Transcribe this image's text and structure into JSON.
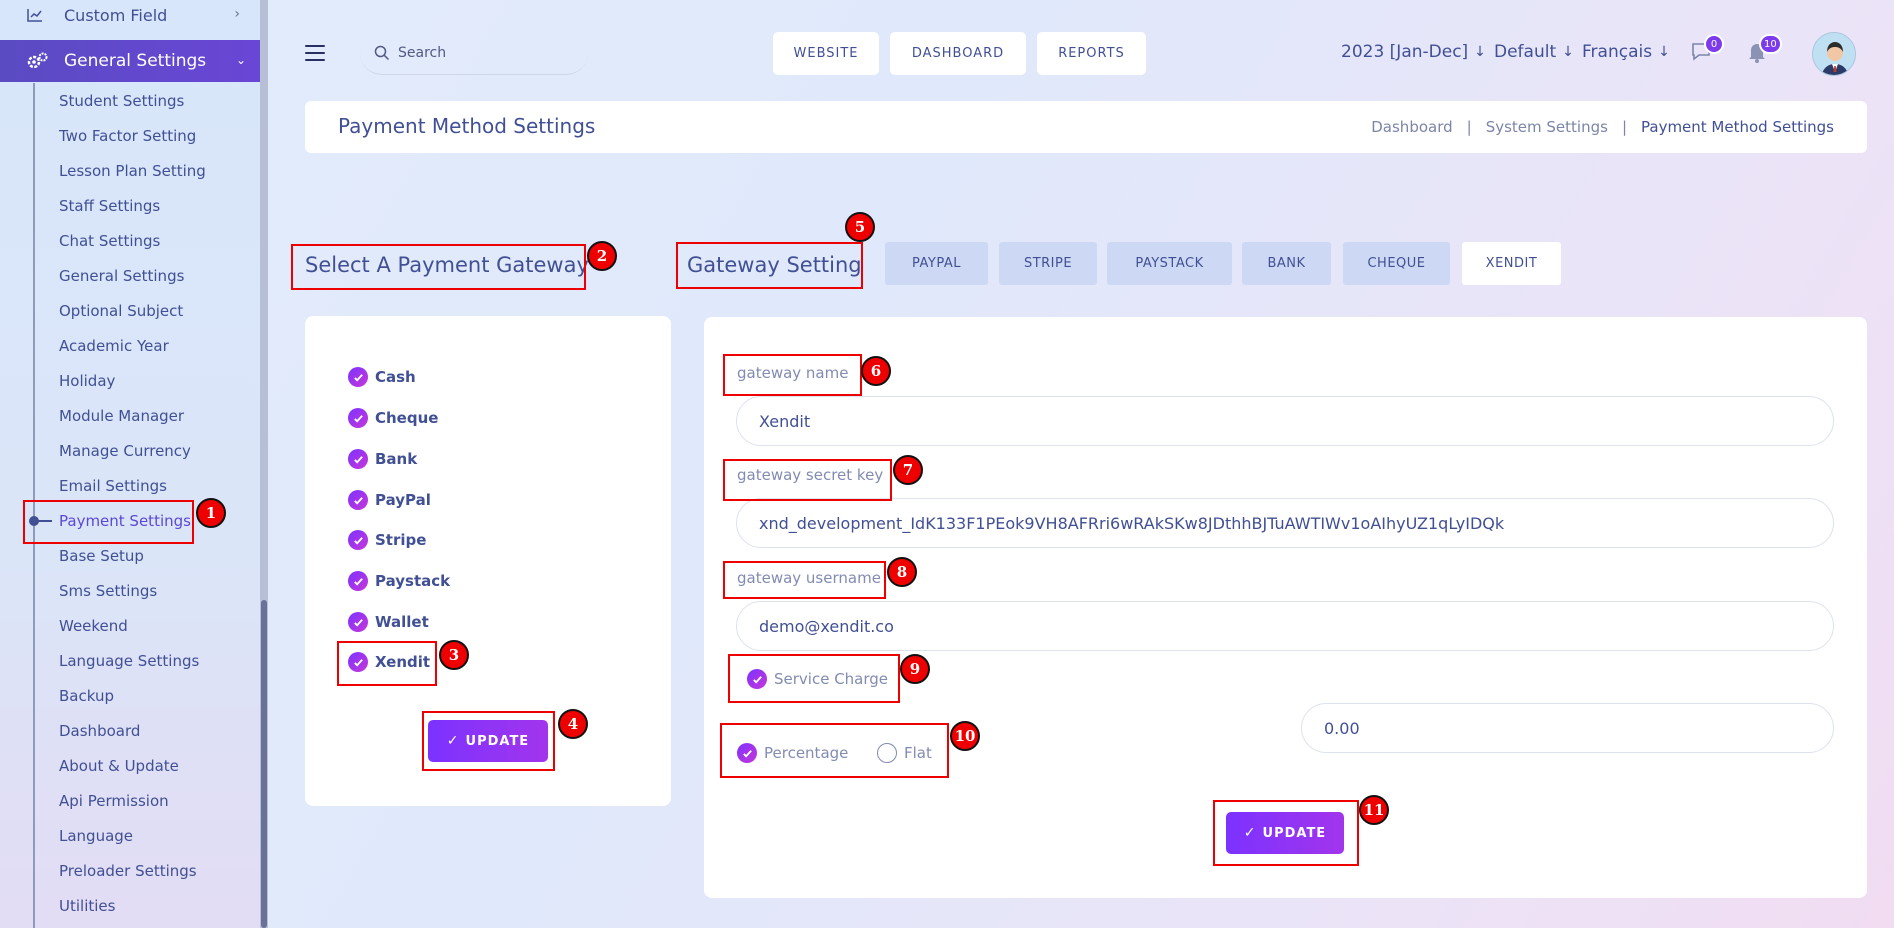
{
  "sidebar": {
    "top_item": "Custom Field",
    "active_group": "General Settings",
    "items": [
      "Student Settings",
      "Two Factor Setting",
      "Lesson Plan Setting",
      "Staff Settings",
      "Chat Settings",
      "General Settings",
      "Optional Subject",
      "Academic Year",
      "Holiday",
      "Module Manager",
      "Manage Currency",
      "Email Settings",
      "Payment Settings",
      "Base Setup",
      "Sms Settings",
      "Weekend",
      "Language Settings",
      "Backup",
      "Dashboard",
      "About & Update",
      "Api Permission",
      "Language",
      "Preloader Settings",
      "Utilities"
    ]
  },
  "topbar": {
    "search_placeholder": "Search",
    "buttons": {
      "website": "WEBSITE",
      "dashboard": "DASHBOARD",
      "reports": "REPORTS"
    },
    "academic_year": "2023 [Jan-Dec]",
    "theme": "Default",
    "language": "Français",
    "chat_count": "0",
    "notification_count": "10"
  },
  "header": {
    "title": "Payment Method Settings",
    "breadcrumb": [
      "Dashboard",
      "System Settings",
      "Payment Method Settings"
    ],
    "separator": "|"
  },
  "left_panel": {
    "heading": "Select A Payment Gateway",
    "gateways": [
      "Cash",
      "Cheque",
      "Bank",
      "PayPal",
      "Stripe",
      "Paystack",
      "Wallet",
      "Xendit"
    ],
    "update_label": "UPDATE"
  },
  "right_panel": {
    "heading": "Gateway Setting",
    "tabs": [
      "PAYPAL",
      "STRIPE",
      "PAYSTACK",
      "BANK",
      "CHEQUE",
      "XENDIT"
    ],
    "active_tab": "XENDIT",
    "gateway_name_label": "gateway name",
    "gateway_name_value": "Xendit",
    "secret_key_label": "gateway secret key",
    "secret_key_value": "xnd_development_IdK133F1PEok9VH8AFRri6wRAkSKw8JDthhBJTuAWTIWv1oAIhyUZ1qLyIDQk",
    "username_label": "gateway username",
    "username_value": "demo@xendit.co",
    "service_charge_label": "Service Charge",
    "charge_types": [
      "Percentage",
      "Flat"
    ],
    "charge_amount": "0.00",
    "update_label": "UPDATE"
  },
  "annotations": [
    "1",
    "2",
    "3",
    "4",
    "5",
    "6",
    "7",
    "8",
    "9",
    "10",
    "11"
  ],
  "colors": {
    "accent": "#7c32ff",
    "text": "#415094",
    "annotation": "#ee0000"
  }
}
